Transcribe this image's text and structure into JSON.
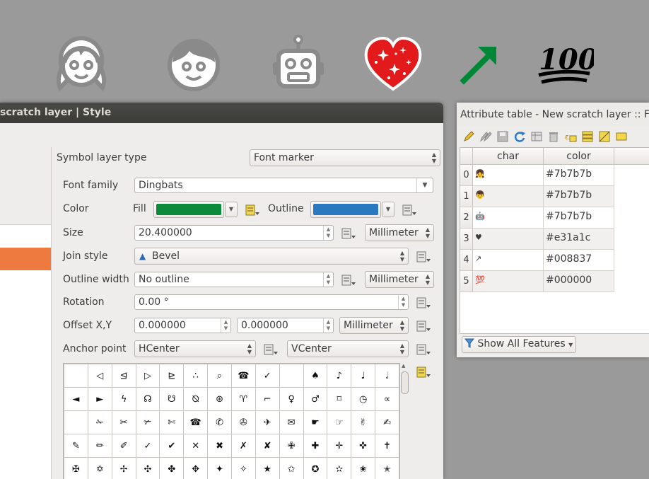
{
  "emojis": [
    {
      "icon": "girl-face-icon"
    },
    {
      "icon": "boy-face-icon"
    },
    {
      "icon": "robot-face-icon"
    },
    {
      "icon": "sparkling-heart-icon",
      "color": "#e31a1c"
    },
    {
      "icon": "north-east-arrow-icon",
      "color": "#008837"
    },
    {
      "icon": "hundred-points-icon",
      "color": "#000000"
    }
  ],
  "style_dialog": {
    "title": " scratch layer | Style",
    "symbol_layer_type_label": "Symbol layer type",
    "symbol_layer_type_value": "Font marker",
    "font_family_label": "Font family",
    "font_family_value": "Dingbats",
    "color_label": "Color",
    "fill_label": "Fill",
    "fill_color": "#0a8a3a",
    "outline_label": "Outline",
    "outline_color": "#2a78c0",
    "size_label": "Size",
    "size_value": "20.400000",
    "size_unit": "Millimeter",
    "join_style_label": "Join style",
    "join_style_value": "Bevel",
    "outline_width_label": "Outline width",
    "outline_width_value": "No outline",
    "outline_width_unit": "Millimeter",
    "rotation_label": "Rotation",
    "rotation_value": "0.00 °",
    "offset_label": "Offset X,Y",
    "offset_x": "0.000000",
    "offset_y": "0.000000",
    "offset_unit": "Millimeter",
    "anchor_label": "Anchor point",
    "anchor_h": "HCenter",
    "anchor_v": "VCenter",
    "glyph_rows": [
      [
        "",
        "◁",
        "⊴",
        "▷",
        "⊵",
        "∴",
        "⌕",
        "☎",
        "✓",
        "",
        "♠",
        "♪",
        "♩",
        "𝅗𝅥"
      ],
      [
        "◄",
        "►",
        "ϟ",
        "☊",
        "☋",
        "⦰",
        "⊛",
        "♈",
        "⌐",
        "♀",
        "♂",
        "⌑",
        "◷",
        "∝"
      ],
      [
        "",
        "✁",
        "✂",
        "✃",
        "✄",
        "☎",
        "✆",
        "✇",
        "✈",
        "✉",
        "☛",
        "☞",
        "✌",
        "✍"
      ],
      [
        "✎",
        "✏",
        "✐",
        "✓",
        "✔",
        "✕",
        "✖",
        "✗",
        "✘",
        "✙",
        "✚",
        "✛",
        "✜",
        "✝"
      ],
      [
        "✠",
        "✡",
        "✢",
        "✣",
        "✤",
        "✥",
        "✦",
        "✧",
        "★",
        "✩",
        "✪",
        "✫",
        "✬",
        "✭"
      ]
    ]
  },
  "attribute_table": {
    "title": "Attribute table - New scratch layer :: Fea",
    "columns": [
      "char",
      "color"
    ],
    "rows": [
      {
        "num": "0",
        "char": "👧",
        "color": "#7b7b7b"
      },
      {
        "num": "1",
        "char": "👦",
        "color": "#7b7b7b"
      },
      {
        "num": "2",
        "char": "🤖",
        "color": "#7b7b7b"
      },
      {
        "num": "3",
        "char": "♥",
        "color": "#e31a1c"
      },
      {
        "num": "4",
        "char": "↗",
        "color": "#008837"
      },
      {
        "num": "5",
        "char": "💯",
        "color": "#000000"
      }
    ],
    "show_all_label": "Show All Features"
  }
}
